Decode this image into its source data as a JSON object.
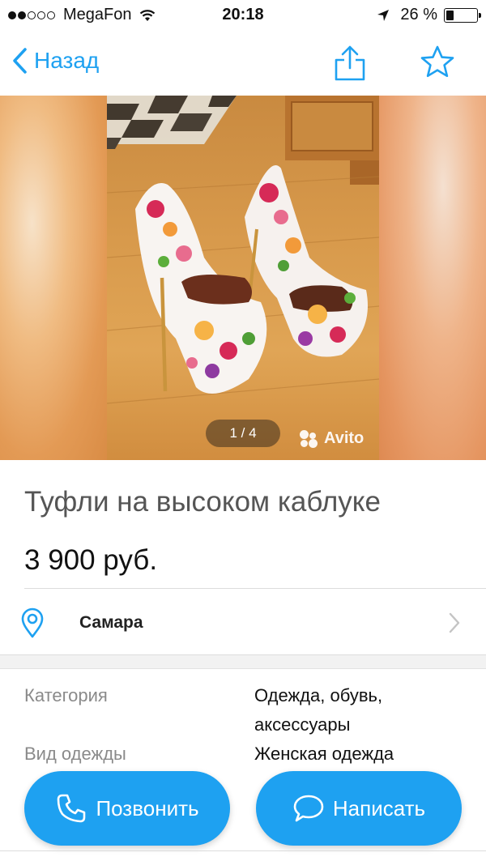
{
  "status_bar": {
    "carrier": "MegaFon",
    "time": "20:18",
    "battery": "26 %",
    "battery_level_percent": 26,
    "signal_bars_filled": 2,
    "signal_bars_total": 5
  },
  "nav": {
    "back_label": "Назад",
    "share_icon": "share-icon",
    "favorite_icon": "star-icon",
    "accent_color": "#1ea1f1"
  },
  "gallery": {
    "counter": "1 / 4",
    "watermark": "Avito"
  },
  "listing": {
    "title": "Туфли на высоком каблуке",
    "price": "3 900 руб.",
    "location": "Самара"
  },
  "params": [
    {
      "label": "Категория",
      "value_line1": "Одежда, обувь,",
      "value_line2": "аксессуары"
    },
    {
      "label": "Вид одежды",
      "value_line1": "Женская одежда",
      "value_line2": ""
    }
  ],
  "actions": {
    "call_label": "Позвонить",
    "message_label": "Написать"
  }
}
